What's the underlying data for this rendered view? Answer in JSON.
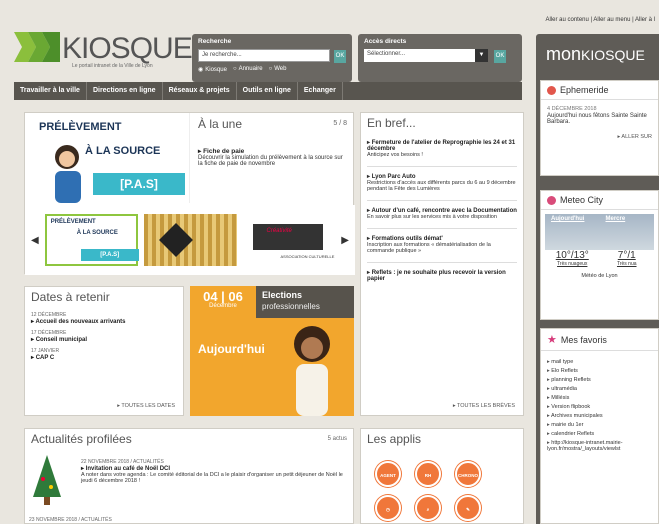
{
  "skip_links": "Aller au contenu | Aller au menu | Aller à l",
  "logo": {
    "name": "KIOSQUE",
    "subtitle": "Le portail intranet de la Ville de Lyon"
  },
  "search": {
    "label": "Recherche",
    "placeholder": "Je recherche...",
    "ok": "OK",
    "options": [
      "Kiosque",
      "Annuaire",
      "Web"
    ],
    "selected": "Kiosque"
  },
  "acces": {
    "label": "Accès directs",
    "value": "Sélectionner...",
    "ok": "OK"
  },
  "nav": [
    "Travailler à la ville",
    "Directions en ligne",
    "Réseaux & projets",
    "Outils en ligne",
    "Echanger"
  ],
  "mon_kiosque": {
    "title_a": "mon",
    "title_b": "KIOSQUE"
  },
  "ephemeride": {
    "title": "Ephemeride",
    "date": "4 DÉCEMBRE 2018",
    "text": "Aujourd'hui nous fêtons Sainte Sainte Barbara.",
    "more": "▸ ALLER SUR"
  },
  "meteo": {
    "title": "Meteo City",
    "day1": "Aujourd'hui",
    "day2": "Mercre",
    "temp1": "10°/13°",
    "temp2": "7°/1",
    "sub1": "Très nuageux",
    "sub2": "Très nua",
    "city": "Météo de Lyon"
  },
  "favoris": {
    "title": "Mes favoris",
    "items": [
      "mail type",
      "Elo Reflets",
      "planning Reflets",
      "ultramédia",
      "Millésis",
      "Version flipbook",
      "Archives municipales",
      "mairie du 1er",
      "calendrier Reflets",
      "http://kiosque-intranet.mairie-lyon.fr/mostra/_layouts/viewlst"
    ]
  },
  "slider": {
    "pas_line1": "PRÉLÈVEMENT",
    "pas_line2": "À LA SOURCE",
    "pas_band": "[P.A.S]",
    "alaune_title": "À la une",
    "alaune_count": "5 / 8",
    "item_title": "Fiche de paie",
    "item_desc": "Découvrir la simulation du prélèvement à la source sur la fiche de paie de novembre",
    "th1_a": "PRÉLÈVEMENT",
    "th1_b": "À LA SOURCE",
    "th1_c": "[P.A.S]",
    "th3_text": "Créativité",
    "th3_cap": "ASSOCIATION CULTURELLE"
  },
  "enbref": {
    "title": "En bref...",
    "items": [
      {
        "title": "Fermeture de l'atelier de Reprographie les 24 et 31 décembre",
        "desc": "Anticipez vos besoins !"
      },
      {
        "title": "Lyon Parc Auto",
        "desc": "Restrictions d'accès aux différents parcs du 6 au 9 décembre pendant la Fête des Lumières"
      },
      {
        "title": "Autour d'un café, rencontre avec la Documentation",
        "desc": "En savoir plus sur les services mis à votre disposition"
      },
      {
        "title": "Formations outils démat'",
        "desc": "Inscription aux formations « dématérialisation de la commande publique »"
      },
      {
        "title": "Reflets : je ne souhaite plus recevoir la version papier",
        "desc": ""
      }
    ],
    "foot": "▸ TOUTES LES BRÈVES"
  },
  "dates": {
    "title": "Dates à retenir",
    "items": [
      {
        "date": "12 DÉCEMBRE",
        "label": "Accueil des nouveaux arrivants"
      },
      {
        "date": "17 DÉCEMBRE",
        "label": "Conseil municipal"
      },
      {
        "date": "17 JANVIER",
        "label": "CAP C"
      }
    ],
    "foot": "▸ TOUTES LES DATES"
  },
  "elections": {
    "date": "04 | 06",
    "month": "Décembre",
    "title": "Elections",
    "subtitle": "professionnelles",
    "today": "Aujourd'hui"
  },
  "actu": {
    "title": "Actualités profilées",
    "count": "5 actus",
    "meta": "22 NOVEMBRE 2018 / ACTUALITÉS",
    "item_title": "Invitation au café de Noël DCI",
    "item_desc": "A noter dans votre agenda : Le comité éditorial de la DCI a le plaisir d'organiser un petit déjeuner de Noël le jeudi 6 décembre 2018 !",
    "meta2": "23 NOVEMBRE 2018 / ACTUALITÉS"
  },
  "applis": {
    "title": "Les applis",
    "icons": [
      "AGENT",
      "RH",
      "CHRONO"
    ]
  },
  "colors": {
    "accent": "#58a6a0",
    "nav": "#58554f",
    "orange": "#f2a62d",
    "teal": "#3ab8c9"
  }
}
